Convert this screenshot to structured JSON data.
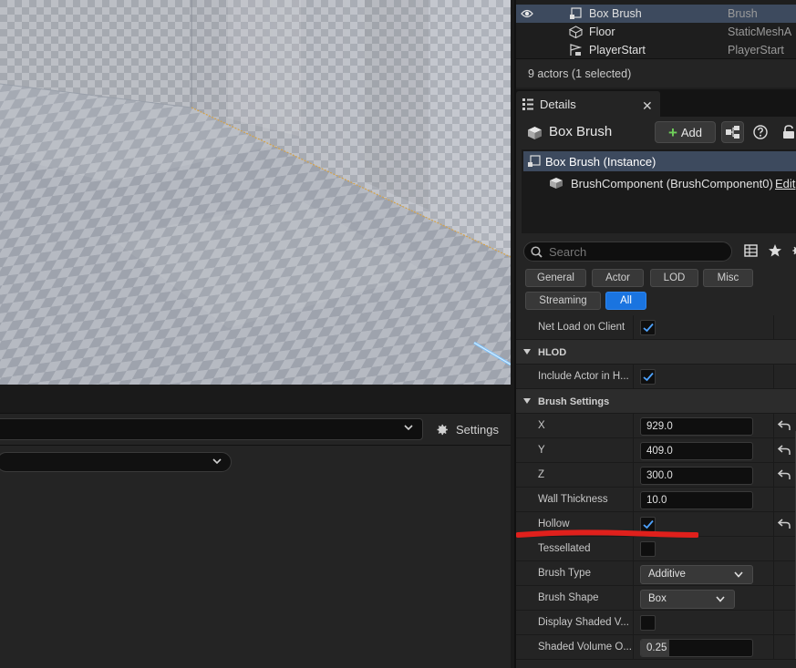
{
  "outliner": {
    "rows": [
      {
        "name": "Box Brush",
        "type": "Brush",
        "selected": true
      },
      {
        "name": "Floor",
        "type": "StaticMeshA"
      },
      {
        "name": "PlayerStart",
        "type": "PlayerStart"
      }
    ],
    "status": "9 actors (1 selected)"
  },
  "details": {
    "tab_title": "Details",
    "close_glyph": "✕",
    "actor_name": "Box Brush",
    "add_label": "Add",
    "add_glyph": "+",
    "components": [
      {
        "label": "Box Brush (Instance)"
      },
      {
        "label": "BrushComponent (BrushComponent0)",
        "action": "Edit"
      }
    ],
    "search_placeholder": "Search",
    "filters": [
      "General",
      "Actor",
      "LOD",
      "Misc",
      "Streaming",
      "All"
    ],
    "active_filter": "All",
    "properties": {
      "net_load": {
        "label": "Net Load on Client",
        "checked": true
      },
      "hlod_category": "HLOD",
      "include_actor": {
        "label": "Include Actor in H...",
        "checked": true
      },
      "brush_category": "Brush Settings",
      "x": {
        "label": "X",
        "value": "929.0"
      },
      "y": {
        "label": "Y",
        "value": "409.0"
      },
      "z": {
        "label": "Z",
        "value": "300.0"
      },
      "wall_thickness": {
        "label": "Wall Thickness",
        "value": "10.0"
      },
      "hollow": {
        "label": "Hollow",
        "checked": true
      },
      "tessellated": {
        "label": "Tessellated",
        "checked": false
      },
      "brush_type": {
        "label": "Brush Type",
        "value": "Additive"
      },
      "brush_shape": {
        "label": "Brush Shape",
        "value": "Box"
      },
      "display_shaded": {
        "label": "Display Shaded V...",
        "checked": false
      },
      "shaded_opacity": {
        "label": "Shaded Volume O...",
        "value": "0.25",
        "fraction": 0.25
      }
    }
  },
  "bottom_panel": {
    "settings_label": "Settings"
  },
  "colors": {
    "accent": "#1a74e0",
    "selection": "#3d4a5e",
    "annotation": "#e0201c",
    "check": "#4ea3ff"
  }
}
